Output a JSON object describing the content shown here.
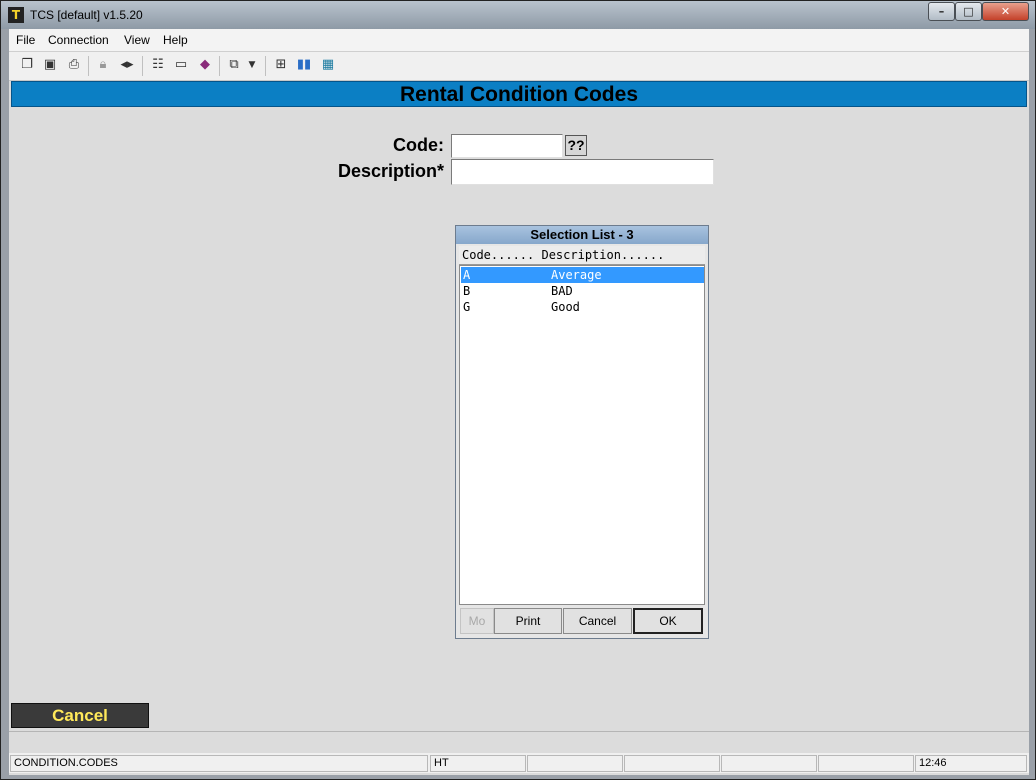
{
  "window": {
    "title": "TCS [default]  v1.5.20",
    "min": "–",
    "max": "□",
    "close": "✕"
  },
  "menu": [
    {
      "label": "File"
    },
    {
      "label": "Connection"
    },
    {
      "label": "View"
    },
    {
      "label": "Help"
    }
  ],
  "toolbar": {
    "icons": [
      "copy-icon",
      "save-icon",
      "print-icon",
      "lock-icon",
      "audio-icon",
      "properties-icon",
      "monitor-icon",
      "book-icon",
      "screens-icon",
      "dropdown-arrow-icon",
      "tree-icon",
      "bar-chart-icon",
      "calculator-icon"
    ]
  },
  "header": {
    "title": "Rental Condition Codes"
  },
  "form": {
    "code_label": "Code:",
    "code_value": "",
    "lookup_label": "??",
    "description_label": "Description*",
    "description_value": ""
  },
  "selection_list": {
    "title": "Selection List - 3",
    "column_header": "Code...... Description......",
    "rows": [
      {
        "code": "A",
        "description": "Average",
        "selected": true
      },
      {
        "code": "B",
        "description": "BAD",
        "selected": false
      },
      {
        "code": "G",
        "description": "Good",
        "selected": false
      }
    ],
    "buttons": {
      "more": "Mo",
      "print": "Print",
      "cancel": "Cancel",
      "ok": "OK"
    }
  },
  "footer": {
    "cancel_label": "Cancel"
  },
  "status": {
    "program": "CONDITION.CODES",
    "mode": "HT",
    "time": "12:46"
  },
  "colors": {
    "header_bar": "#0b7fc4",
    "selection": "#3399ff",
    "cancel_text": "#ffe95a"
  }
}
